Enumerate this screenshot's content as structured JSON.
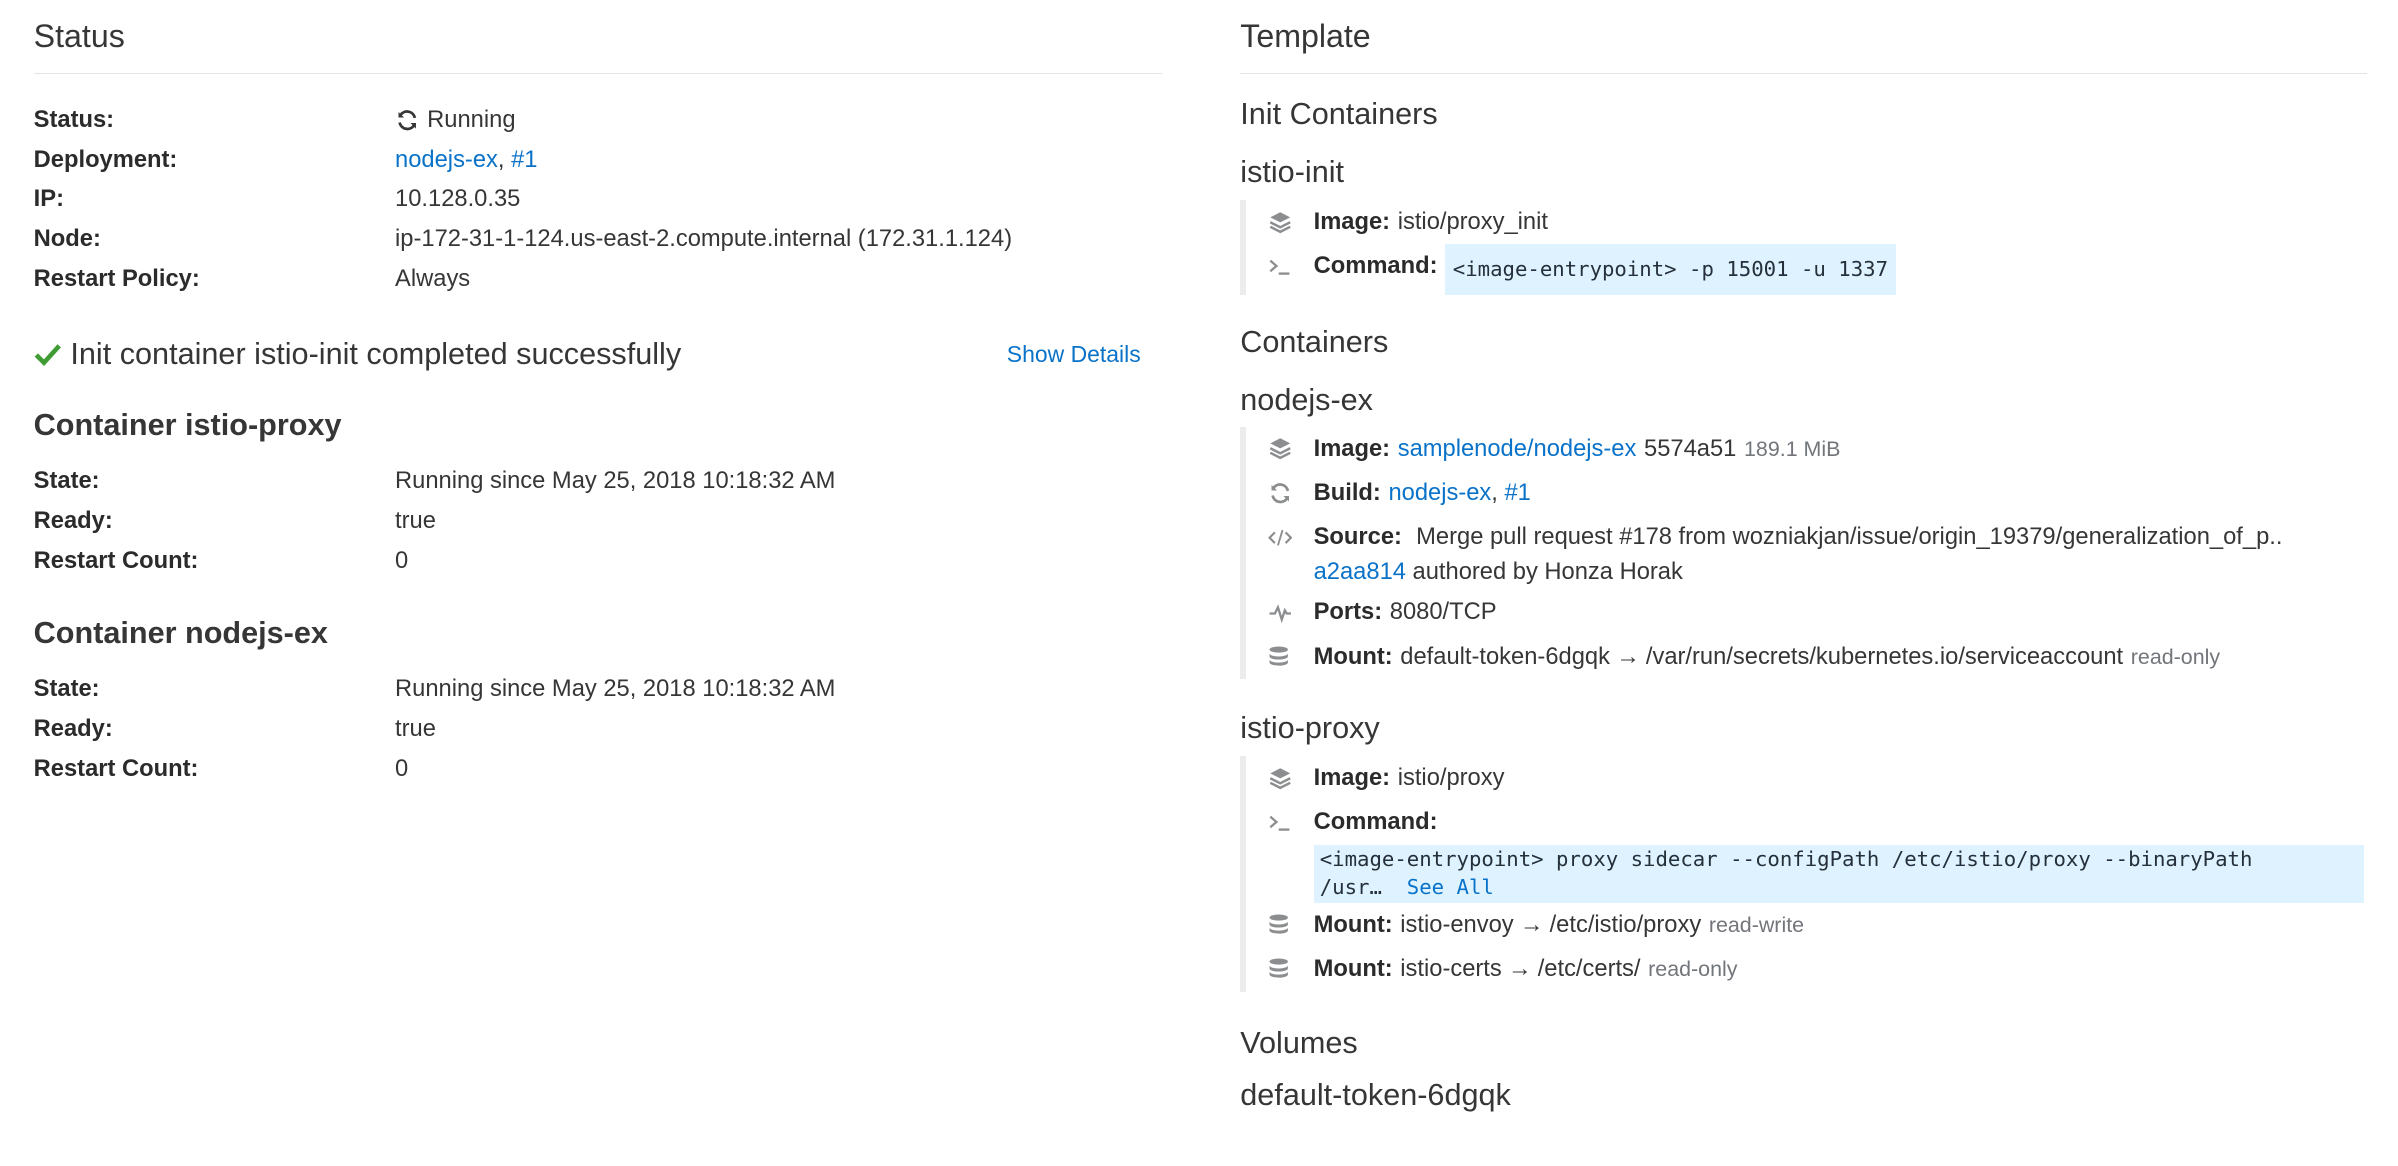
{
  "status": {
    "title": "Status",
    "rows": [
      {
        "key": "Status:",
        "value": "Running"
      },
      {
        "key": "Deployment:",
        "link1": "nodejs-ex",
        "sep": ",",
        "link2": "#1"
      },
      {
        "key": "IP:",
        "value": "10.128.0.35"
      },
      {
        "key": "Node:",
        "value": "ip-172-31-1-124.us-east-2.compute.internal (172.31.1.124)"
      },
      {
        "key": "Restart Policy:",
        "value": "Always"
      }
    ],
    "init_message": "Init container istio-init completed successfully",
    "show_details": "Show Details",
    "containers": [
      {
        "title": "Container istio-proxy",
        "rows": [
          {
            "key": "State:",
            "value": "Running since May 25, 2018 10:18:32 AM"
          },
          {
            "key": "Ready:",
            "value": "true"
          },
          {
            "key": "Restart Count:",
            "value": "0"
          }
        ]
      },
      {
        "title": "Container nodejs-ex",
        "rows": [
          {
            "key": "State:",
            "value": "Running since May 25, 2018 10:18:32 AM"
          },
          {
            "key": "Ready:",
            "value": "true"
          },
          {
            "key": "Restart Count:",
            "value": "0"
          }
        ]
      }
    ]
  },
  "template": {
    "title": "Template",
    "init_containers_heading": "Init Containers",
    "init": {
      "name": "istio-init",
      "image_label": "Image:",
      "image": "istio/proxy_init",
      "command_label": "Command:",
      "command": "<image-entrypoint> -p 15001 -u 1337"
    },
    "containers_heading": "Containers",
    "nodejs": {
      "name": "nodejs-ex",
      "image_label": "Image:",
      "image_link": "samplenode/nodejs-ex",
      "image_id": "5574a51",
      "image_size": "189.1 MiB",
      "build_label": "Build:",
      "build_link1": "nodejs-ex",
      "build_sep": ",",
      "build_link2": "#1",
      "source_label": "Source:",
      "source_text": "Merge pull request #178 from wozniakjan/issue/origin_19379/generalization_of_p..",
      "commit_link": "a2aa814",
      "commit_text": "authored by Honza Horak",
      "ports_label": "Ports:",
      "ports": "8080/TCP",
      "mount_label": "Mount:",
      "mount_name": "default-token-6dgqk",
      "mount_arrow": "→",
      "mount_path": "/var/run/secrets/kubernetes.io/serviceaccount",
      "mount_mode": "read-only"
    },
    "proxy": {
      "name": "istio-proxy",
      "image_label": "Image:",
      "image": "istio/proxy",
      "command_label": "Command:",
      "command_line1": "<image-entrypoint> proxy sidecar --configPath /etc/istio/proxy --binaryPath",
      "command_line2": "/usr…",
      "see_all": "See All",
      "mount1_label": "Mount:",
      "mount1_name": "istio-envoy",
      "mount1_arrow": "→",
      "mount1_path": "/etc/istio/proxy",
      "mount1_mode": "read-write",
      "mount2_label": "Mount:",
      "mount2_name": "istio-certs",
      "mount2_arrow": "→",
      "mount2_path": "/etc/certs/",
      "mount2_mode": "read-only"
    },
    "volumes_heading": "Volumes",
    "volume_name": "default-token-6dgqk"
  }
}
